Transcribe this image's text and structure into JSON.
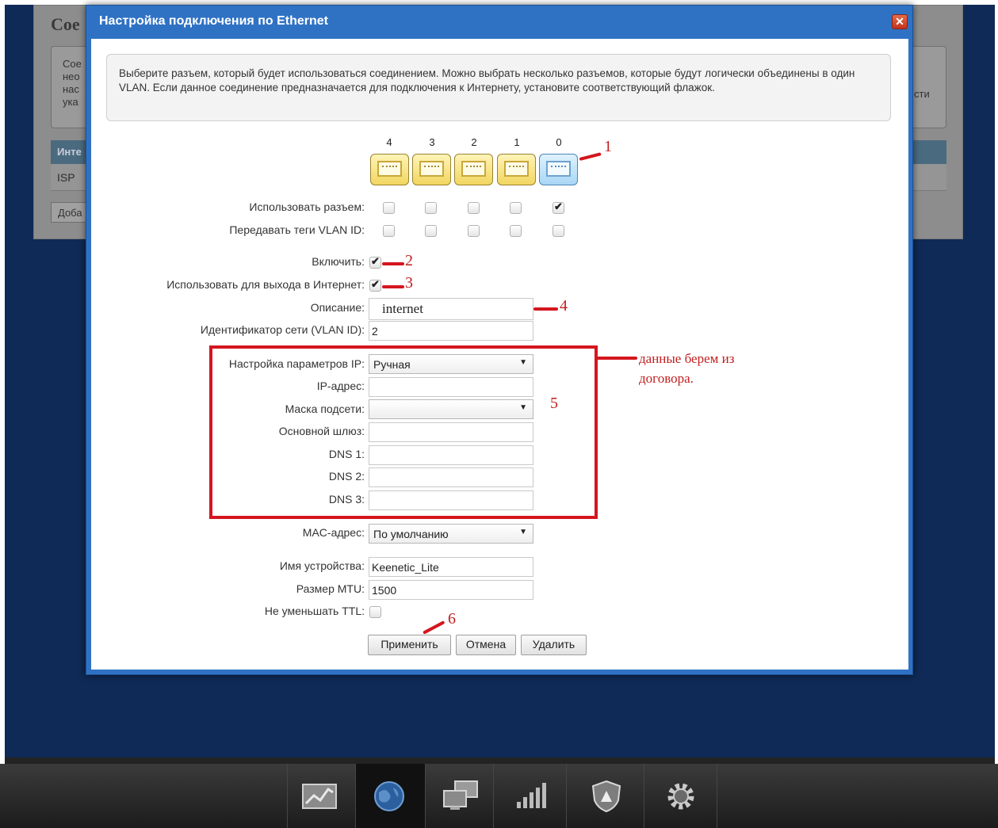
{
  "background": {
    "page_title": "Сое",
    "description_lines": [
      "Сое",
      "нео",
      "нас",
      "ука"
    ],
    "description_right": "сти",
    "table_header": "Инте",
    "table_row": "ISP",
    "add_button": "Доба"
  },
  "dialog": {
    "title": "Настройка подключения по Ethernet",
    "close": "✕",
    "info": "Выберите разъем, который будет использоваться соединением. Можно выбрать несколько разъемов, которые будут логически объединены в один VLAN. Если данное соединение предназначается для подключения к Интернету, установите соответствующий флажок.",
    "ports": [
      {
        "label": "4",
        "use": false,
        "vlan_tags": false,
        "color": "yellow"
      },
      {
        "label": "3",
        "use": false,
        "vlan_tags": false,
        "color": "yellow"
      },
      {
        "label": "2",
        "use": false,
        "vlan_tags": false,
        "color": "yellow"
      },
      {
        "label": "1",
        "use": false,
        "vlan_tags": false,
        "color": "yellow"
      },
      {
        "label": "0",
        "use": true,
        "vlan_tags": false,
        "color": "blue"
      }
    ],
    "labels": {
      "use_port": "Использовать разъем:",
      "vlan_tags": "Передавать теги VLAN ID:",
      "enable": "Включить:",
      "internet": "Использовать для выхода в Интернет:",
      "description": "Описание:",
      "vlan_id": "Идентификатор сети (VLAN ID):",
      "ip_settings": "Настройка параметров IP:",
      "ip_address": "IP-адрес:",
      "subnet_mask": "Маска подсети:",
      "gateway": "Основной шлюз:",
      "dns1": "DNS 1:",
      "dns2": "DNS 2:",
      "dns3": "DNS 3:",
      "mac": "MAC-адрес:",
      "device_name": "Имя устройства:",
      "mtu": "Размер MTU:",
      "ttl": "Не уменьшать TTL:"
    },
    "values": {
      "enable": true,
      "internet": true,
      "description": "internet",
      "vlan_id": "2",
      "ip_settings": "Ручная",
      "ip_address": "",
      "subnet_mask": "",
      "gateway": "",
      "dns1": "",
      "dns2": "",
      "dns3": "",
      "mac": "По умолчанию",
      "device_name": "Keenetic_Lite",
      "mtu": "1500",
      "ttl": false
    },
    "buttons": {
      "apply": "Применить",
      "cancel": "Отмена",
      "delete": "Удалить"
    }
  },
  "annotations": {
    "n1": "1",
    "n2": "2",
    "n3": "3",
    "n4": "4",
    "n5": "5",
    "n6": "6",
    "note": "данные берем из договора.",
    "color": "#d4161e"
  },
  "taskbar": {
    "icons": [
      "monitoring-icon",
      "internet-globe-icon",
      "network-computers-icon",
      "wifi-signal-icon",
      "security-shield-icon",
      "settings-gear-icon"
    ],
    "active": "internet-globe-icon"
  }
}
